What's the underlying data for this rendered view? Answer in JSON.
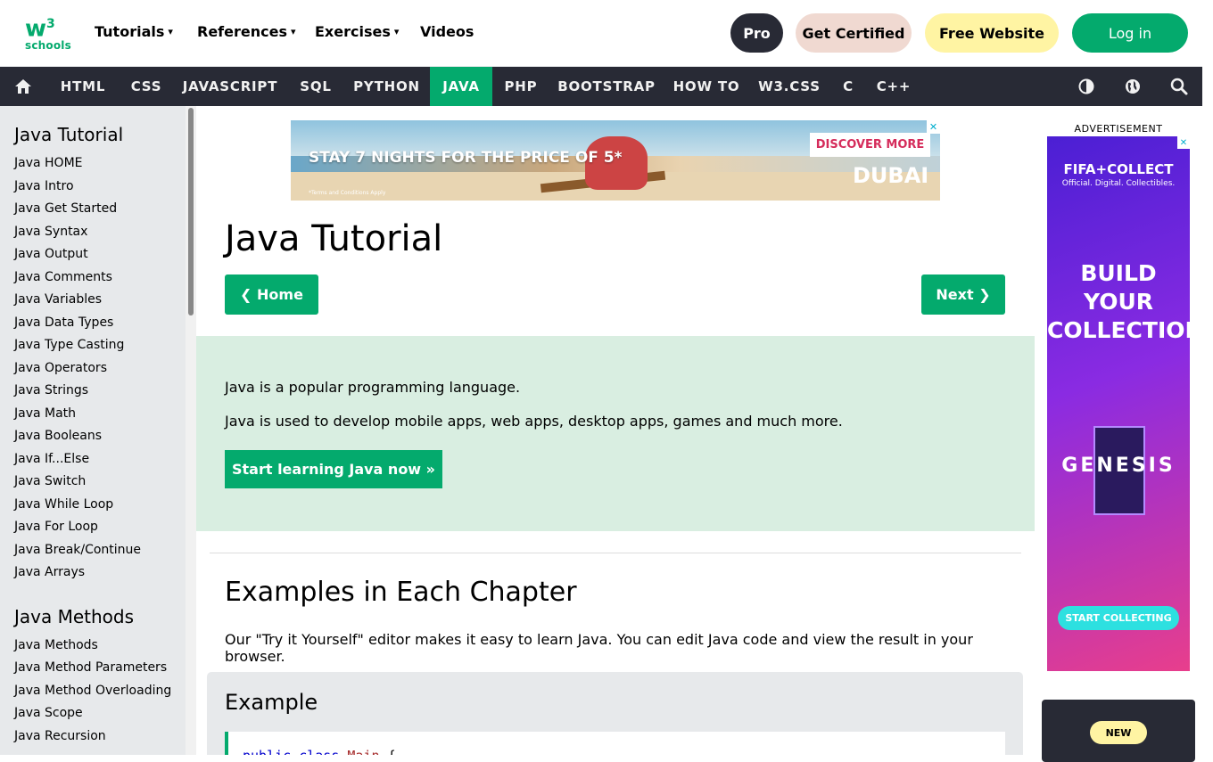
{
  "logo": {
    "mark": "w",
    "sup": "3",
    "sub": "schools"
  },
  "topnav": [
    {
      "label": "Tutorials",
      "caret": "▾"
    },
    {
      "label": "References",
      "caret": "▾"
    },
    {
      "label": "Exercises",
      "caret": "▾"
    },
    {
      "label": "Videos"
    }
  ],
  "header_buttons": {
    "pro": "Pro",
    "certified": "Get Certified",
    "free_website": "Free Website",
    "login": "Log in"
  },
  "navbar": {
    "items": [
      "HTML",
      "CSS",
      "JAVASCRIPT",
      "SQL",
      "PYTHON",
      "JAVA",
      "PHP",
      "BOOTSTRAP",
      "HOW TO",
      "W3.CSS",
      "C",
      "C++"
    ],
    "active": "JAVA",
    "icons": {
      "home": "home-icon",
      "theme": "contrast-icon",
      "language": "globe-icon",
      "search": "search-icon"
    }
  },
  "sidebar": {
    "sections": [
      {
        "title": "Java Tutorial",
        "links": [
          "Java HOME",
          "Java Intro",
          "Java Get Started",
          "Java Syntax",
          "Java Output",
          "Java Comments",
          "Java Variables",
          "Java Data Types",
          "Java Type Casting",
          "Java Operators",
          "Java Strings",
          "Java Math",
          "Java Booleans",
          "Java If...Else",
          "Java Switch",
          "Java While Loop",
          "Java For Loop",
          "Java Break/Continue",
          "Java Arrays"
        ]
      },
      {
        "title": "Java Methods",
        "links": [
          "Java Methods",
          "Java Method Parameters",
          "Java Method Overloading",
          "Java Scope",
          "Java Recursion"
        ]
      }
    ]
  },
  "ad_banner": {
    "headline": "STAY 7 NIGHTS FOR THE PRICE OF 5*",
    "terms": "*Terms and Conditions Apply",
    "cta": "DISCOVER MORE",
    "brand": "DUBAI",
    "close": "✕"
  },
  "main": {
    "title": "Java Tutorial",
    "prev_label": "❮ Home",
    "next_label": "Next ❯",
    "intro": {
      "p1": "Java is a popular programming language.",
      "p2": "Java is used to develop mobile apps, web apps, desktop apps, games and much more.",
      "cta": "Start learning Java now »"
    },
    "examples_heading": "Examples in Each Chapter",
    "examples_desc": "Our \"Try it Yourself\" editor makes it easy to learn Java. You can edit Java code and view the result in your browser.",
    "example_title": "Example",
    "code_line": {
      "kw1": "public",
      "kw2": "class",
      "cls": "Main",
      "brace": "{"
    }
  },
  "right_ad": {
    "label": "ADVERTISEMENT",
    "brand": "FIFA+COLLECT",
    "tag": "Official. Digital. Collectibles.",
    "big": [
      "BUILD",
      "YOUR",
      "COLLECTION"
    ],
    "product": "GENESIS",
    "cta": "START COLLECTING",
    "close": "✕",
    "promo_badge": "NEW"
  },
  "colors": {
    "accent": "#04aa6d",
    "dark": "#282a35",
    "sidebar_bg": "#e7e9eb",
    "intro_bg": "#d9eee1",
    "yellow": "#fff4a3"
  }
}
